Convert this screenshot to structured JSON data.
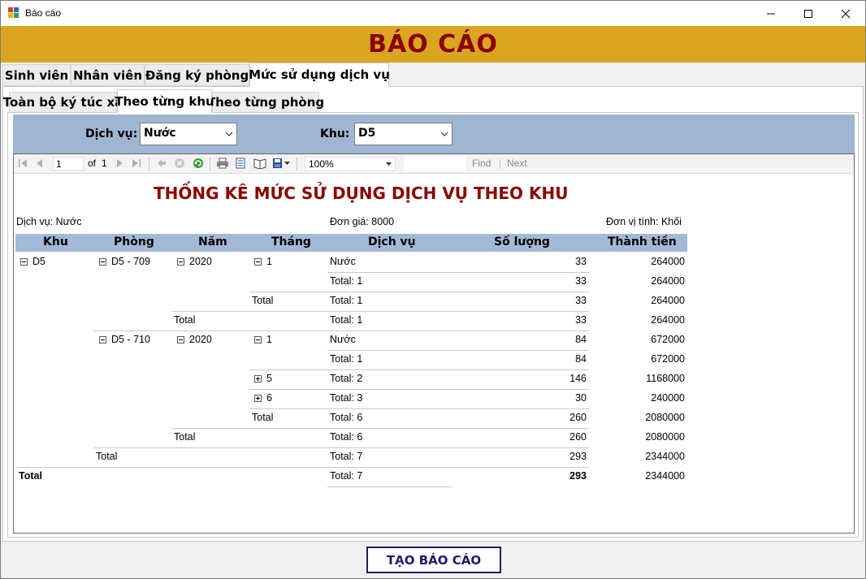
{
  "window": {
    "title": "Báo cáo"
  },
  "banner": {
    "title": "BÁO CÁO"
  },
  "main_tabs": [
    {
      "label": "Sinh viên"
    },
    {
      "label": "Nhân viên"
    },
    {
      "label": "Đăng ký phòng"
    },
    {
      "label": "Mức sử dụng dịch vụ"
    }
  ],
  "sub_tabs": [
    {
      "label": "Toàn bộ ký túc xá"
    },
    {
      "label": "Theo từng khu"
    },
    {
      "label": "Theo từng phòng"
    }
  ],
  "filters": {
    "service_label": "Dịch vụ:",
    "service_value": "Nước",
    "area_label": "Khu:",
    "area_value": "D5"
  },
  "toolbar": {
    "page": "1",
    "of_label": "of",
    "total_pages": "1",
    "zoom": "100%",
    "find_label": "Find",
    "next_label": "Next"
  },
  "report": {
    "title": "THỐNG KÊ MỨC SỬ DỤNG DỊCH VỤ THEO KHU",
    "service_info": "Dịch vụ: Nước",
    "unit_price": "Đơn giá: 8000",
    "unit": "Đơn vị tính: Khối",
    "headers": [
      "Khu",
      "Phòng",
      "Năm",
      "Tháng",
      "Dịch vụ",
      "Số lượng",
      "Thành tiền"
    ],
    "rows": [
      {
        "khu": "D5",
        "phong": "D5 - 709",
        "nam": "2020",
        "thang": "1",
        "dichvu": "Nước",
        "soluong": "33",
        "thanhtien": "264000"
      },
      {
        "dichvu": "Total: 1",
        "soluong": "33",
        "thanhtien": "264000"
      },
      {
        "thang": "Total",
        "dichvu": "Total: 1",
        "soluong": "33",
        "thanhtien": "264000"
      },
      {
        "nam": "Total",
        "dichvu": "Total: 1",
        "soluong": "33",
        "thanhtien": "264000"
      },
      {
        "phong": "D5 - 710",
        "nam": "2020",
        "thang": "1",
        "dichvu": "Nước",
        "soluong": "84",
        "thanhtien": "672000"
      },
      {
        "dichvu": "Total: 1",
        "soluong": "84",
        "thanhtien": "672000"
      },
      {
        "thang": "5",
        "dichvu": "Total: 2",
        "soluong": "146",
        "thanhtien": "1168000"
      },
      {
        "thang": "6",
        "dichvu": "Total: 3",
        "soluong": "30",
        "thanhtien": "240000"
      },
      {
        "thang": "Total",
        "dichvu": "Total: 6",
        "soluong": "260",
        "thanhtien": "2080000"
      },
      {
        "nam": "Total",
        "dichvu": "Total: 6",
        "soluong": "260",
        "thanhtien": "2080000"
      },
      {
        "phong": "Total",
        "dichvu": "Total: 7",
        "soluong": "293",
        "thanhtien": "2344000"
      },
      {
        "khu": "Total",
        "dichvu": "Total: 7",
        "soluong": "293",
        "thanhtien": "2344000"
      }
    ]
  },
  "action": {
    "label": "TẠO BÁO CÁO"
  },
  "colors": {
    "banner": "#daa520",
    "title_red": "#8b0000",
    "filter_bar": "#9fb6d3",
    "header_bg": "#a3b9d6",
    "button_text": "#1a1a6e"
  }
}
